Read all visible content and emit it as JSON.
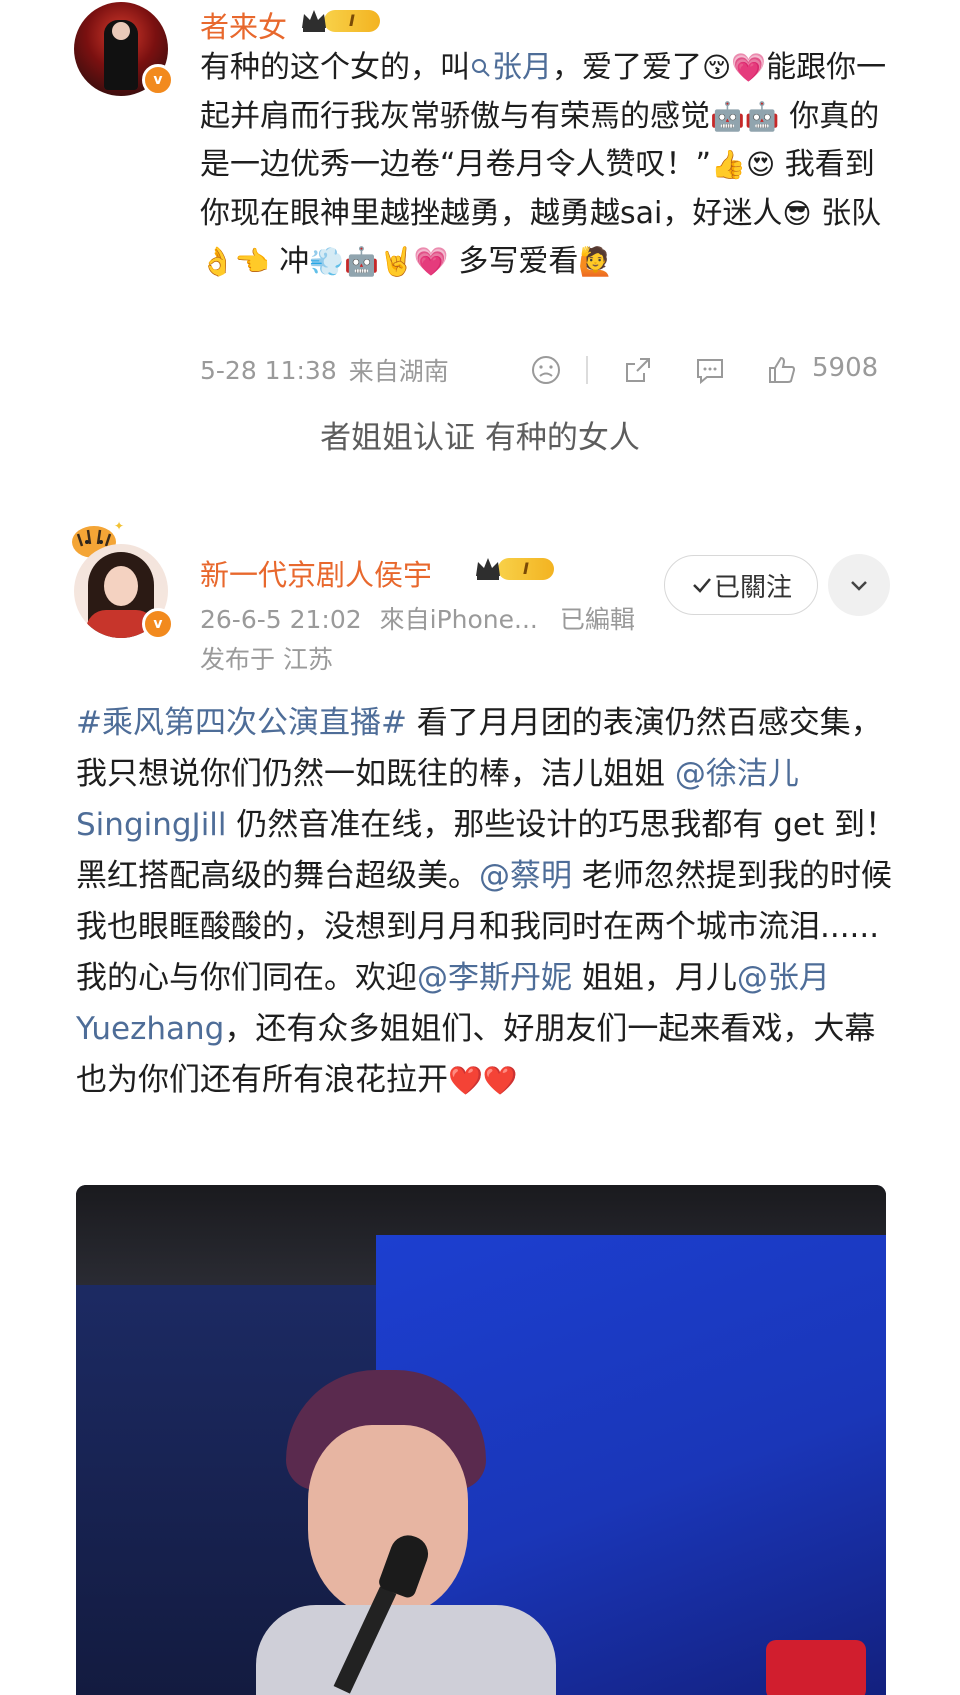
{
  "comment1": {
    "username": "者来女",
    "level_badge": "I",
    "text_parts": [
      {
        "t": "有种的这个女的，叫"
      },
      {
        "t": "张月",
        "link": true,
        "search": true
      },
      {
        "t": "，爱了爱了"
      },
      {
        "e": "😚"
      },
      {
        "e": "💗"
      },
      {
        "t": "能跟你一起并肩而行我灰常骄傲与有荣焉的感觉"
      },
      {
        "e": "🤖"
      },
      {
        "e": "🤖"
      },
      {
        "t": " 你真的是一边优秀一边卷“月卷月令人赞叹！”"
      },
      {
        "e": "👍"
      },
      {
        "e": "😍"
      },
      {
        "t": " 我看到你现在眼神里越挫越勇，越勇越sai，好迷人"
      },
      {
        "e": "😎"
      },
      {
        "t": " 张队"
      },
      {
        "e": "👌"
      },
      {
        "e": "👈"
      },
      {
        "t": " 冲"
      },
      {
        "e": "💨"
      },
      {
        "e": "🤖"
      },
      {
        "e": "🤘"
      },
      {
        "e": "💗"
      },
      {
        "t": " 多写爱看"
      },
      {
        "e": "🙋"
      }
    ],
    "time": "5-28 11:38",
    "source": "来自湖南",
    "likes": "5908"
  },
  "caption": "者姐姐认证 有种的女人",
  "post2": {
    "username": "新一代京剧人侯宇",
    "level_badge": "I",
    "time": "26-6-5 21:02",
    "source": "來自iPhone...",
    "edited": "已編輯",
    "location": "发布于 江苏",
    "follow_label": "已關注",
    "text_parts": [
      {
        "t": "#乘风第四次公演直播#",
        "link": true
      },
      {
        "t": " 看了月月团的表演仍然百感交集，我只想说你们仍然一如既往的棒，洁儿姐姐 "
      },
      {
        "t": "@徐洁儿 SingingJill",
        "link": true
      },
      {
        "t": " 仍然音准在线，那些设计的巧思我都有 get 到！黑红搭配高级的舞台超级美。"
      },
      {
        "t": "@蔡明",
        "link": true
      },
      {
        "t": " 老师忽然提到我的时候我也眼眶酸酸的，没想到月月和我同时在两个城市流泪......我的心与你们同在。欢迎"
      },
      {
        "t": "@李斯丹妮",
        "link": true
      },
      {
        "t": " 姐姐，月儿"
      },
      {
        "t": "@张月 Yuezhang",
        "link": true
      },
      {
        "t": "，还有众多姐姐们、好朋友们一起来看戏，大幕也为你们还有所有浪花拉开"
      },
      {
        "e": "❤️"
      },
      {
        "e": "❤️"
      }
    ]
  },
  "colors": {
    "username": "#e8682d",
    "link": "#4e6d98",
    "meta": "#9a9a9a",
    "verified_badge": "#f28a1e"
  }
}
